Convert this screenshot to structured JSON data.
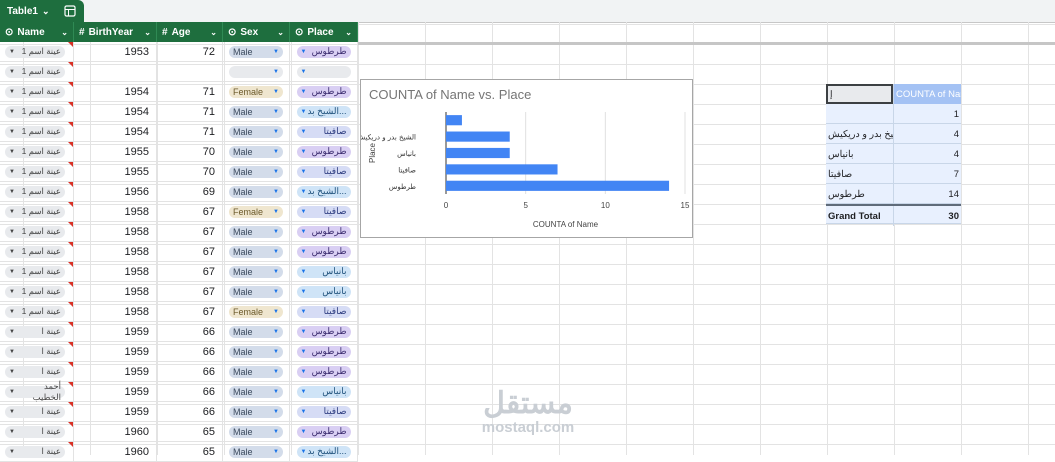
{
  "window": {
    "sheet_tab": "Table1",
    "icons": {
      "tab_chevron": "chevron-down-icon",
      "table_icon": "table-settings-icon"
    }
  },
  "table": {
    "columns": [
      {
        "icon": "⊙",
        "label": "Name"
      },
      {
        "icon": "#",
        "label": "BirthYear"
      },
      {
        "icon": "#",
        "label": "Age"
      },
      {
        "icon": "⊙",
        "label": "Sex"
      },
      {
        "icon": "⊙",
        "label": "Place"
      }
    ],
    "rows": [
      {
        "name": "عينة اسم 1",
        "birth": "1953",
        "age": "72",
        "sex": "Male",
        "place": "طرطوس",
        "pc": "a"
      },
      {
        "name": "عينة اسم 1",
        "birth": "",
        "age": "",
        "sex": "",
        "place": "",
        "pc": "e"
      },
      {
        "name": "عينة اسم 1",
        "birth": "1954",
        "age": "71",
        "sex": "Female",
        "place": "طرطوس",
        "pc": "a"
      },
      {
        "name": "عينة اسم 1",
        "birth": "1954",
        "age": "71",
        "sex": "Male",
        "place": "الشيخ بد...",
        "pc": "b"
      },
      {
        "name": "عينة اسم 1",
        "birth": "1954",
        "age": "71",
        "sex": "Male",
        "place": "صافيتا",
        "pc": "u"
      },
      {
        "name": "عينة اسم 1",
        "birth": "1955",
        "age": "70",
        "sex": "Male",
        "place": "طرطوس",
        "pc": "a"
      },
      {
        "name": "عينة اسم 1",
        "birth": "1955",
        "age": "70",
        "sex": "Male",
        "place": "صافيتا",
        "pc": "u"
      },
      {
        "name": "عينة اسم 1",
        "birth": "1956",
        "age": "69",
        "sex": "Male",
        "place": "الشيخ بد...",
        "pc": "b"
      },
      {
        "name": "عينة اسم 1",
        "birth": "1958",
        "age": "67",
        "sex": "Female",
        "place": "صافيتا",
        "pc": "u"
      },
      {
        "name": "عينة اسم 1",
        "birth": "1958",
        "age": "67",
        "sex": "Male",
        "place": "طرطوس",
        "pc": "a"
      },
      {
        "name": "عينة اسم 1",
        "birth": "1958",
        "age": "67",
        "sex": "Male",
        "place": "طرطوس",
        "pc": "a"
      },
      {
        "name": "عينة اسم 1",
        "birth": "1958",
        "age": "67",
        "sex": "Male",
        "place": "بانياس",
        "pc": "b"
      },
      {
        "name": "عينة اسم 1",
        "birth": "1958",
        "age": "67",
        "sex": "Male",
        "place": "بانياس",
        "pc": "b"
      },
      {
        "name": "عينة اسم 1",
        "birth": "1958",
        "age": "67",
        "sex": "Female",
        "place": "صافيتا",
        "pc": "u"
      },
      {
        "name": "عينة ا",
        "birth": "1959",
        "age": "66",
        "sex": "Male",
        "place": "طرطوس",
        "pc": "a"
      },
      {
        "name": "عينة ا",
        "birth": "1959",
        "age": "66",
        "sex": "Male",
        "place": "طرطوس",
        "pc": "a"
      },
      {
        "name": "عينة ا",
        "birth": "1959",
        "age": "66",
        "sex": "Male",
        "place": "طرطوس",
        "pc": "a"
      },
      {
        "name": "أحمد الخطيب",
        "birth": "1959",
        "age": "66",
        "sex": "Male",
        "place": "بانياس",
        "pc": "b"
      },
      {
        "name": "عينة ا",
        "birth": "1959",
        "age": "66",
        "sex": "Male",
        "place": "صافيتا",
        "pc": "u"
      },
      {
        "name": "عينة ا",
        "birth": "1960",
        "age": "65",
        "sex": "Male",
        "place": "طرطوس",
        "pc": "a"
      },
      {
        "name": "عينة ا",
        "birth": "1960",
        "age": "65",
        "sex": "Male",
        "place": "الشيخ بد...",
        "pc": "b"
      }
    ]
  },
  "chart_data": {
    "type": "bar",
    "orientation": "horizontal",
    "title": "COUNTA of Name vs. Place",
    "xlabel": "COUNTA of Name",
    "ylabel": "Place",
    "categories": [
      "",
      "الشيخ بدر و دريكيش",
      "بانياس",
      "صافيتا",
      "طرطوس"
    ],
    "values": [
      1,
      4,
      4,
      7,
      14
    ],
    "xlim": [
      0,
      15
    ],
    "xticks": [
      "0",
      "5",
      "10",
      "15"
    ],
    "grid": true,
    "bar_color": "#4285f4"
  },
  "pivot": {
    "corner": "إ",
    "header": "COUNTA of Name",
    "rows": [
      {
        "label": "",
        "value": "1"
      },
      {
        "label": "الشيخ بدر و دريكيش",
        "value": "4"
      },
      {
        "label": "بانياس",
        "value": "4"
      },
      {
        "label": "صافيتا",
        "value": "7"
      },
      {
        "label": "طرطوس",
        "value": "14"
      }
    ],
    "total_label": "Grand Total",
    "total_value": "30"
  },
  "watermark": {
    "arabic": "مستقل",
    "latin": "mostaql.com"
  }
}
